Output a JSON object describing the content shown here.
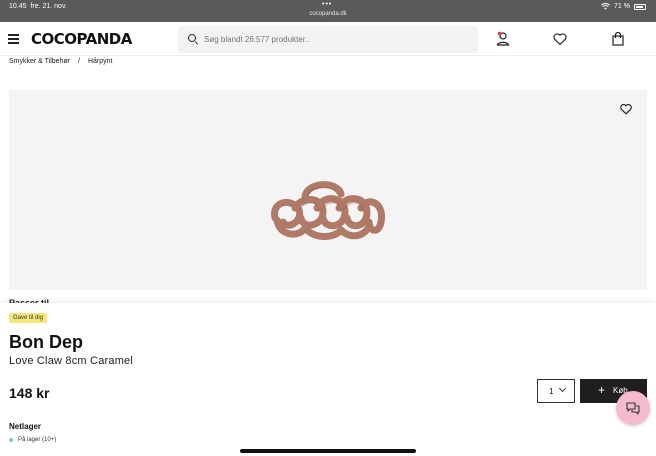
{
  "status_bar": {
    "time": "10.45",
    "date": "fre. 21. nov.",
    "url": "cocopanda.dk",
    "battery": "71 %"
  },
  "header": {
    "logo": "COCOPANDA",
    "search_placeholder": "Søg blandt 26.577 produkter..",
    "icons": [
      "menu-icon",
      "search-icon",
      "user-icon",
      "heart-icon",
      "bag-icon"
    ]
  },
  "breadcrumb": {
    "items": [
      "Smykker & Tilbehør",
      "Hårpynt"
    ],
    "separator": "/"
  },
  "product_image": {
    "alt": "Love Claw 8cm Caramel hair clip",
    "color": "#b07a66"
  },
  "peek_text": "Passer til",
  "product": {
    "badge": "Gave til dig",
    "brand": "Bon Dep",
    "name": "Love Claw 8cm Caramel",
    "price": "148 kr",
    "quantity": "1",
    "buy_label": "Køb",
    "stock_heading": "Netlager",
    "stock_status": "På lager (10+)",
    "stock_color": "#6fd3b8",
    "badge_color": "#f7e77a"
  }
}
